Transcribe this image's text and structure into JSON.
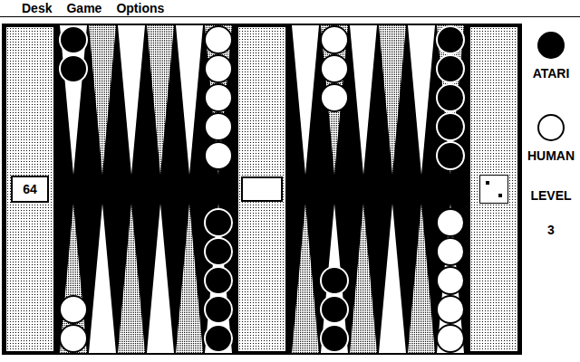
{
  "menu": [
    {
      "label": "Desk"
    },
    {
      "label": "Game"
    },
    {
      "label": "Options"
    }
  ],
  "players": [
    {
      "id": "atari",
      "name": "ATARI",
      "color": "#000000"
    },
    {
      "id": "human",
      "name": "HUMAN",
      "color": "#ffffff"
    }
  ],
  "level": {
    "label": "LEVEL",
    "value": "3"
  },
  "cube": "64",
  "die": {
    "pips": 2
  },
  "board": {
    "top_left": [
      {
        "checkers": 2,
        "owner": "atari"
      },
      {
        "checkers": 0,
        "owner": "none"
      },
      {
        "checkers": 0,
        "owner": "none"
      },
      {
        "checkers": 0,
        "owner": "none"
      },
      {
        "checkers": 0,
        "owner": "none"
      },
      {
        "checkers": 5,
        "owner": "human"
      }
    ],
    "top_right": [
      {
        "checkers": 0,
        "owner": "none"
      },
      {
        "checkers": 3,
        "owner": "human"
      },
      {
        "checkers": 0,
        "owner": "none"
      },
      {
        "checkers": 0,
        "owner": "none"
      },
      {
        "checkers": 0,
        "owner": "none"
      },
      {
        "checkers": 5,
        "owner": "atari"
      }
    ],
    "bottom_left": [
      {
        "checkers": 2,
        "owner": "human"
      },
      {
        "checkers": 0,
        "owner": "none"
      },
      {
        "checkers": 0,
        "owner": "none"
      },
      {
        "checkers": 0,
        "owner": "none"
      },
      {
        "checkers": 0,
        "owner": "none"
      },
      {
        "checkers": 5,
        "owner": "atari"
      }
    ],
    "bottom_right": [
      {
        "checkers": 0,
        "owner": "none"
      },
      {
        "checkers": 3,
        "owner": "atari"
      },
      {
        "checkers": 0,
        "owner": "none"
      },
      {
        "checkers": 0,
        "owner": "none"
      },
      {
        "checkers": 0,
        "owner": "none"
      },
      {
        "checkers": 5,
        "owner": "human"
      }
    ]
  }
}
